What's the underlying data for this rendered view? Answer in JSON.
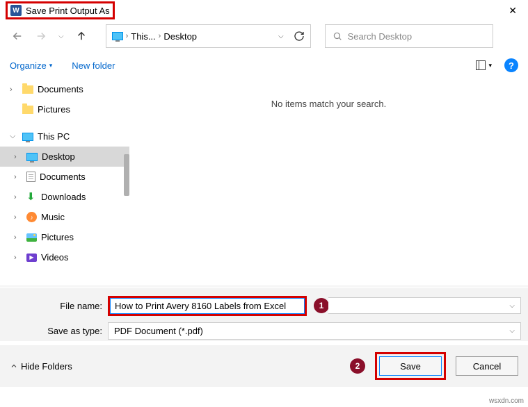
{
  "title": "Save Print Output As",
  "breadcrumb": {
    "part1": "This...",
    "part2": "Desktop"
  },
  "search_placeholder": "Search Desktop",
  "toolbar": {
    "organize": "Organize",
    "new_folder": "New folder"
  },
  "tree": {
    "documents": "Documents",
    "pictures": "Pictures",
    "this_pc": "This PC",
    "desktop": "Desktop",
    "documents2": "Documents",
    "downloads": "Downloads",
    "music": "Music",
    "pictures2": "Pictures",
    "videos": "Videos"
  },
  "empty_msg": "No items match your search.",
  "form": {
    "filename_label": "File name:",
    "filename_value": "How to Print Avery 8160 Labels from Excel",
    "type_label": "Save as type:",
    "type_value": "PDF Document (*.pdf)"
  },
  "footer": {
    "hide": "Hide Folders",
    "save": "Save",
    "cancel": "Cancel"
  },
  "badges": {
    "b1": "1",
    "b2": "2"
  },
  "watermark": "wsxdn.com"
}
